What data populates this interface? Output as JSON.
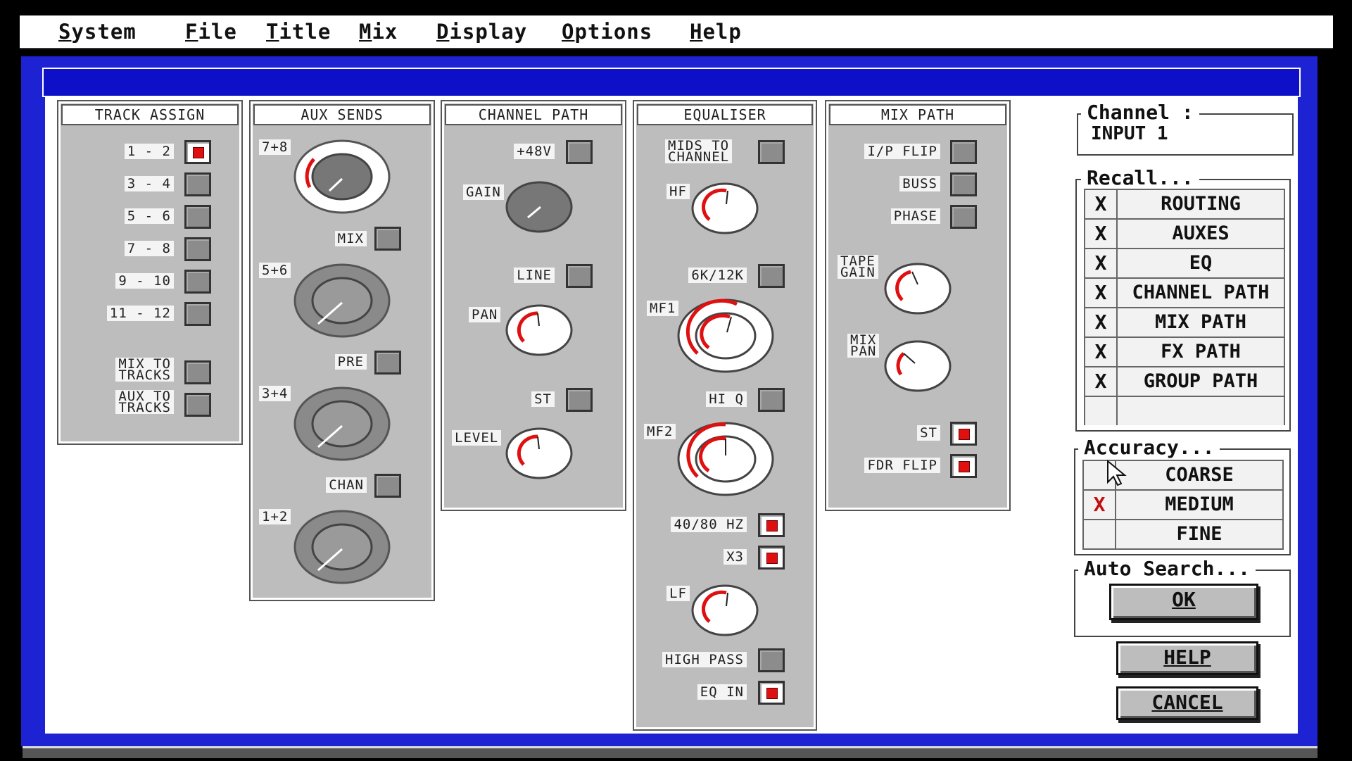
{
  "menu": [
    "System",
    "File",
    "Title",
    "Mix",
    "Display",
    "Options",
    "Help"
  ],
  "track_assign": {
    "title": "TRACK ASSIGN",
    "rows": [
      {
        "label": "1 - 2",
        "on": true
      },
      {
        "label": "3 - 4",
        "on": false
      },
      {
        "label": "5 - 6",
        "on": false
      },
      {
        "label": "7 - 8",
        "on": false
      },
      {
        "label": "9 - 10",
        "on": false
      },
      {
        "label": "11 - 12",
        "on": false
      }
    ],
    "mix_to_tracks": "MIX TO\nTRACKS",
    "aux_to_tracks": "AUX TO\nTRACKS"
  },
  "aux_sends": {
    "title": "AUX SENDS",
    "knob_78": "7+8",
    "knob_56": "5+6",
    "knob_34": "3+4",
    "knob_12": "1+2",
    "mix": "MIX",
    "pre": "PRE",
    "chan": "CHAN"
  },
  "channel_path": {
    "title": "CHANNEL PATH",
    "phantom": "+48V",
    "gain": "GAIN",
    "line": "LINE",
    "pan": "PAN",
    "st": "ST",
    "level": "LEVEL"
  },
  "equaliser": {
    "title": "EQUALISER",
    "mids_to_channel": "MIDS TO\nCHANNEL",
    "hf": "HF",
    "hf_range": "6K/12K",
    "mf1": "MF1",
    "hi_q": "HI Q",
    "mf2": "MF2",
    "lf_range": "40/80 HZ",
    "x3": "X3",
    "lf": "LF",
    "high_pass": "HIGH PASS",
    "eq_in": "EQ IN"
  },
  "mix_path": {
    "title": "MIX PATH",
    "ip_flip": "I/P FLIP",
    "buss": "BUSS",
    "phase": "PHASE",
    "tape_gain": "TAPE\nGAIN",
    "mix_pan": "MIX\nPAN",
    "st": "ST",
    "fdr_flip": "FDR FLIP"
  },
  "channel_box": {
    "title": "Channel :",
    "value": "INPUT 1"
  },
  "recall": {
    "title": "Recall...",
    "items": [
      {
        "mark": "X",
        "label": "ROUTING"
      },
      {
        "mark": "X",
        "label": "AUXES"
      },
      {
        "mark": "X",
        "label": "EQ"
      },
      {
        "mark": "X",
        "label": "CHANNEL PATH"
      },
      {
        "mark": "X",
        "label": "MIX PATH"
      },
      {
        "mark": "X",
        "label": "FX PATH"
      },
      {
        "mark": "X",
        "label": "GROUP PATH"
      }
    ]
  },
  "accuracy": {
    "title": "Accuracy...",
    "items": [
      {
        "mark": "",
        "label": "COARSE"
      },
      {
        "mark": "X",
        "label": "MEDIUM"
      },
      {
        "mark": "",
        "label": "FINE"
      }
    ]
  },
  "auto_search": {
    "title": "Auto Search...",
    "ok": "OK"
  },
  "help_button": "HELP",
  "cancel_button": "CANCEL",
  "colors": {
    "window_blue": "#1d22d2",
    "panel_grey": "#bdbdbd",
    "indicator_red": "#e01010"
  }
}
